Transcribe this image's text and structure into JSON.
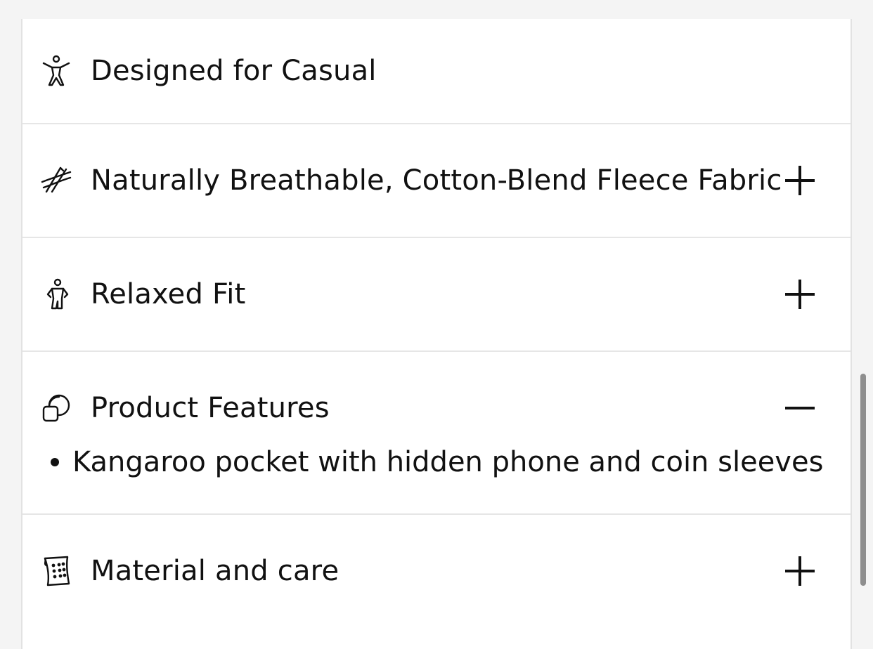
{
  "accordion": {
    "rows": [
      {
        "label": "Designed for Casual",
        "icon": "person-arms-up-icon",
        "expandable": false
      },
      {
        "label": "Naturally Breathable, Cotton-Blend Fleece Fabric",
        "icon": "fabric-wind-icon",
        "toggle": "plus-icon"
      },
      {
        "label": "Relaxed Fit",
        "icon": "body-fit-icon",
        "toggle": "plus-icon"
      },
      {
        "label": "Product Features",
        "icon": "overlap-shapes-icon",
        "toggle": "minus-icon",
        "expanded": true,
        "items": [
          "Kangaroo pocket with hidden phone and coin sleeves"
        ]
      },
      {
        "label": "Material and care",
        "icon": "fabric-swatch-icon",
        "toggle": "plus-icon"
      }
    ]
  },
  "colors": {
    "text": "#111111",
    "divider": "#e6e6e6",
    "background": "#f4f4f4",
    "scrollbar": "#8e8e8e"
  }
}
